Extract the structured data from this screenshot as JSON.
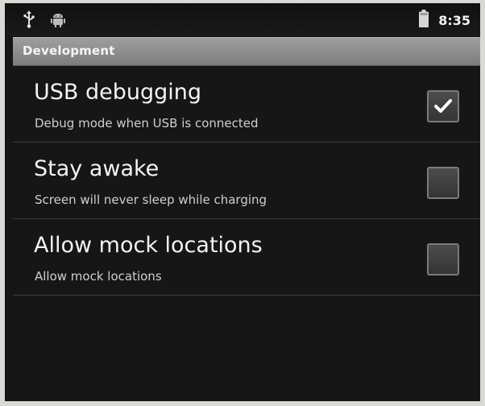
{
  "status_bar": {
    "icons": [
      "usb-icon",
      "android-debug-icon",
      "battery-icon"
    ],
    "time": "8:35"
  },
  "header": {
    "title": "Development"
  },
  "preferences": [
    {
      "title": "USB debugging",
      "summary": "Debug mode when USB is connected",
      "checked": true
    },
    {
      "title": "Stay awake",
      "summary": "Screen will never sleep while charging",
      "checked": false
    },
    {
      "title": "Allow mock locations",
      "summary": "Allow mock locations",
      "checked": false
    }
  ],
  "colors": {
    "background": "#171616",
    "header": "#8f8f8f",
    "text_primary": "#f3f3f3",
    "text_secondary": "#cfcfcf"
  }
}
